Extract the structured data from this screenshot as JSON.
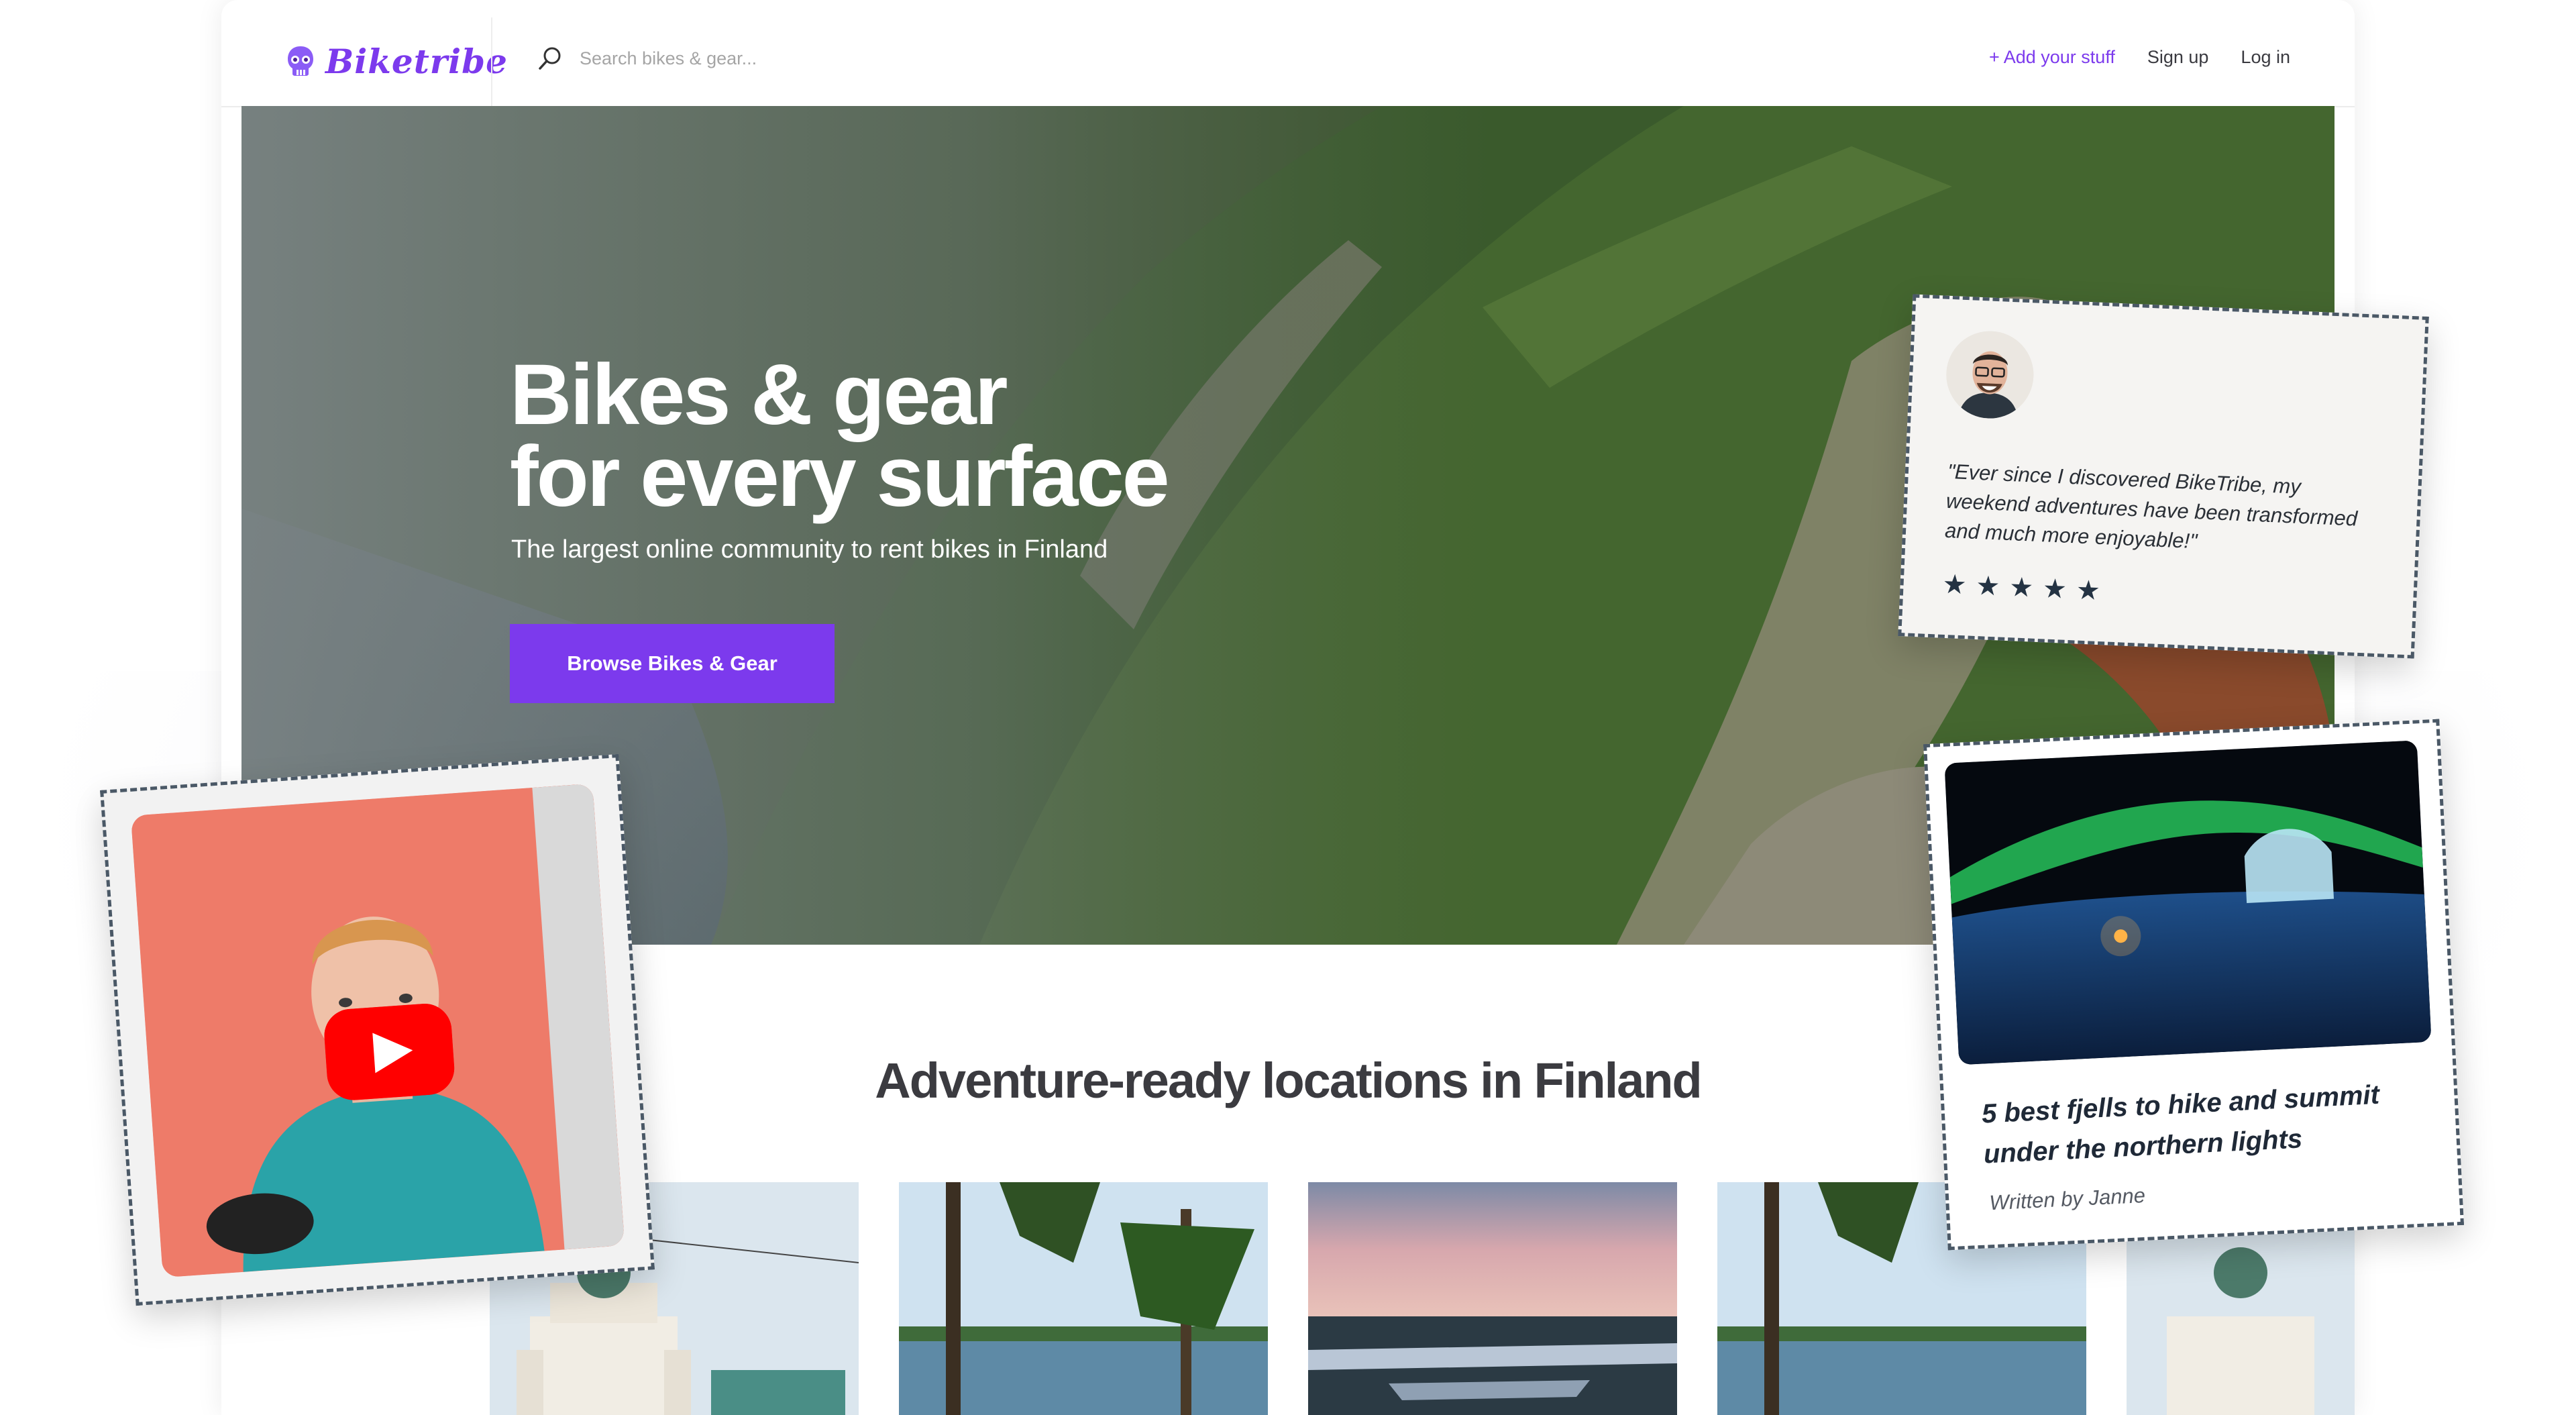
{
  "brand": {
    "name": "Biketribe"
  },
  "search": {
    "placeholder": "Search bikes & gear..."
  },
  "nav": {
    "add_label": "+ Add your stuff",
    "signup_label": "Sign up",
    "login_label": "Log in"
  },
  "hero": {
    "title_line1": "Bikes & gear",
    "title_line2": "for every surface",
    "subtitle": "The largest online community to rent bikes in Finland",
    "cta_label": "Browse Bikes & Gear"
  },
  "locations": {
    "title": "Adventure-ready locations in Finland",
    "cards": [
      {
        "scene": "cathedral"
      },
      {
        "scene": "lake-pines"
      },
      {
        "scene": "sunset-lake"
      },
      {
        "scene": "lake-pines"
      },
      {
        "scene": "cathedral"
      }
    ]
  },
  "testimonial": {
    "quote": "\"Ever since I discovered BikeTribe, my weekend adventures have been transformed and much more enjoyable!\"",
    "rating": 5,
    "star_glyph": "★"
  },
  "blog": {
    "title": "5 best fjells to hike and summit under the northern lights",
    "author": "Written by Janne"
  },
  "video": {
    "play_icon": "youtube-play-icon"
  },
  "colors": {
    "brand": "#7c3aed",
    "stamp_border": "#4a5866",
    "youtube": "#ff0000"
  }
}
